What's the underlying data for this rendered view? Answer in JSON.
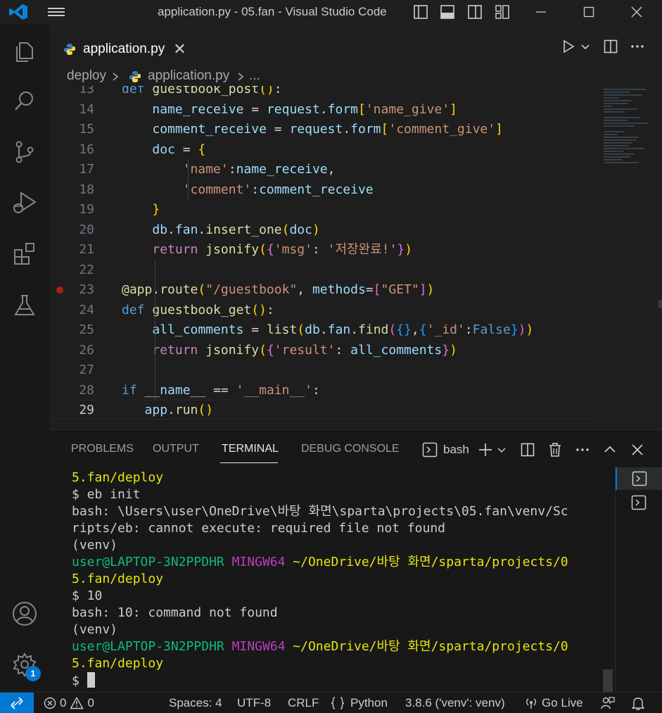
{
  "window": {
    "title": "application.py - 05.fan - Visual Studio Code"
  },
  "tabs": [
    {
      "label": "application.py",
      "close": "✕"
    }
  ],
  "breadcrumb": {
    "folder": "deploy",
    "file": "application.py",
    "more": "..."
  },
  "editor": {
    "lines": [
      {
        "num": "13",
        "text": "def guestbook_post():"
      },
      {
        "num": "14",
        "text": "    name_receive = request.form['name_give']"
      },
      {
        "num": "15",
        "text": "    comment_receive = request.form['comment_give']"
      },
      {
        "num": "16",
        "text": "    doc = {"
      },
      {
        "num": "17",
        "text": "        'name':name_receive,"
      },
      {
        "num": "18",
        "text": "        'comment':comment_receive"
      },
      {
        "num": "19",
        "text": "    }"
      },
      {
        "num": "20",
        "text": "    db.fan.insert_one(doc)"
      },
      {
        "num": "21",
        "text": "    return jsonify({'msg': '저장완료!'})"
      },
      {
        "num": "22",
        "text": ""
      },
      {
        "num": "23",
        "text": "@app.route(\"/guestbook\", methods=[\"GET\"])"
      },
      {
        "num": "24",
        "text": "def guestbook_get():"
      },
      {
        "num": "25",
        "text": "    all_comments = list(db.fan.find({},{'_id':False}))"
      },
      {
        "num": "26",
        "text": "    return jsonify({'result': all_comments})"
      },
      {
        "num": "27",
        "text": ""
      },
      {
        "num": "28",
        "text": "if __name__ == '__main__':"
      },
      {
        "num": "29",
        "text": "   app.run()"
      }
    ]
  },
  "panel": {
    "tabs": {
      "problems": "PROBLEMS",
      "output": "OUTPUT",
      "terminal": "TERMINAL",
      "debug_console": "DEBUG CONSOLE"
    },
    "shell": "bash",
    "terminal_lines": [
      "5.fan/deploy",
      "$ eb init",
      "bash: \\Users\\user\\OneDrive\\바탕 화면\\sparta\\projects\\05.fan\\venv/Sc",
      "ripts/eb: cannot execute: required file not found",
      "(venv)",
      "PROMPT",
      "5.fan/deploy",
      "$ 10",
      "bash: 10: command not found",
      "(venv)",
      "PROMPT",
      "5.fan/deploy",
      "$ "
    ],
    "prompt": {
      "user_host": "user@LAPTOP-3N2PPDHR",
      "env": "MINGW64",
      "path": "~/OneDrive/바탕 화면/sparta/projects/0"
    }
  },
  "status": {
    "errors": "0",
    "warnings": "0",
    "spaces": "Spaces: 4",
    "encoding": "UTF-8",
    "eol": "CRLF",
    "language": "Python",
    "interpreter": "3.8.6 ('venv': venv)",
    "go_live": "Go Live"
  },
  "activity": {
    "settings_badge": "1"
  },
  "colors": {
    "accent": "#0078d4",
    "breakpoint": "#a1260d"
  }
}
